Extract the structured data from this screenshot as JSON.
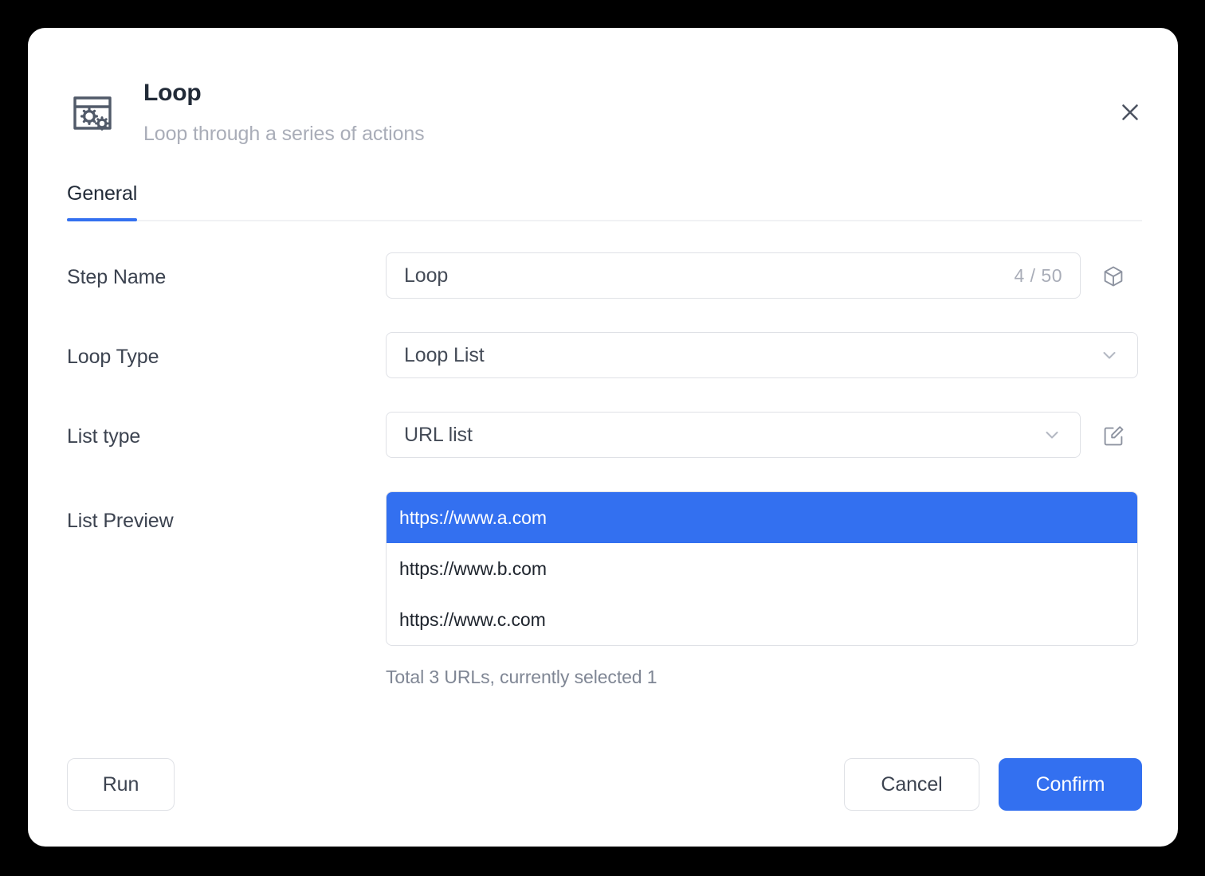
{
  "dialog": {
    "icon": "window-gears-icon",
    "title": "Loop",
    "subtitle": "Loop through a series of actions",
    "close_label": "close-icon"
  },
  "tabs": [
    {
      "label": "General",
      "active": true
    }
  ],
  "form": {
    "step_name": {
      "label": "Step Name",
      "value": "Loop",
      "placeholder": "Step Name",
      "counter": "4 / 50",
      "suffix_icon": "cube-icon"
    },
    "loop_type": {
      "label": "Loop Type",
      "value": "Loop List",
      "options": [
        "Loop List"
      ],
      "chevron": "chevron-down-icon"
    },
    "list_type": {
      "label": "List type",
      "value": "URL list",
      "options": [
        "URL list"
      ],
      "chevron": "chevron-down-icon",
      "suffix_icon": "edit-pencil-icon"
    },
    "list_preview": {
      "label": "List Preview",
      "items": [
        {
          "url": "https://www.a.com",
          "selected": true
        },
        {
          "url": "https://www.b.com",
          "selected": false
        },
        {
          "url": "https://www.c.com",
          "selected": false
        }
      ],
      "hint": "Total 3 URLs, currently selected 1"
    }
  },
  "footer": {
    "run_label": "Run",
    "cancel_label": "Cancel",
    "confirm_label": "Confirm"
  },
  "colors": {
    "accent": "#3370f0",
    "border": "#dfe1e6",
    "text": "#222b38",
    "muted": "#a9adb8",
    "background": "#000000",
    "card": "#ffffff"
  }
}
